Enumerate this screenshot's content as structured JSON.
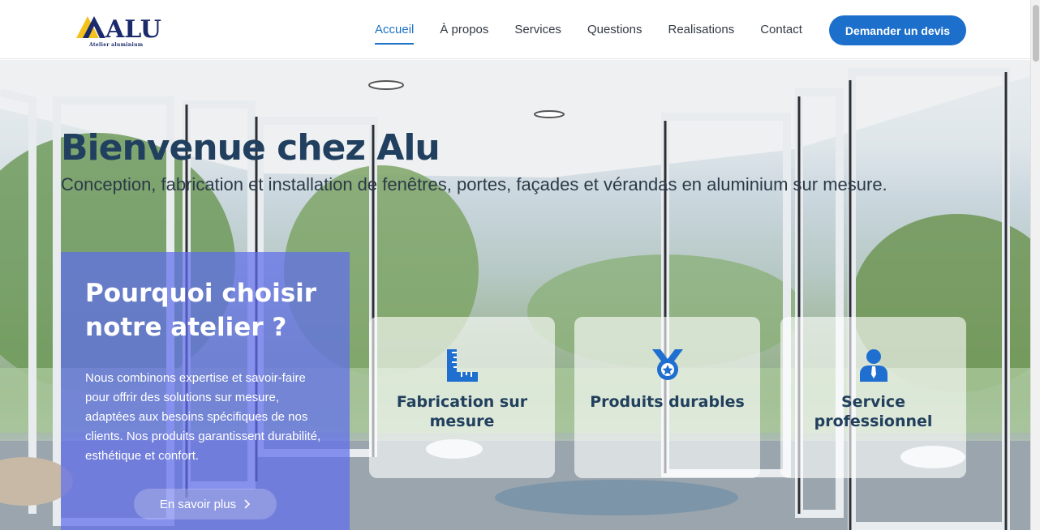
{
  "header": {
    "logo_text": "ALU",
    "logo_subtitle": "Atelier aluminium",
    "nav": [
      {
        "label": "Accueil",
        "active": true
      },
      {
        "label": "À propos",
        "active": false
      },
      {
        "label": "Services",
        "active": false
      },
      {
        "label": "Questions",
        "active": false
      },
      {
        "label": "Realisations",
        "active": false
      },
      {
        "label": "Contact",
        "active": false
      }
    ],
    "cta_label": "Demander un devis"
  },
  "hero": {
    "title": "Bienvenue chez Alu",
    "subtitle": "Conception, fabrication et installation de fenêtres, portes, façades et vérandas en aluminium sur mesure."
  },
  "why": {
    "title": "Pourquoi choisir notre atelier ?",
    "text": "Nous combinons expertise et savoir-faire pour offrir des solutions sur mesure, adaptées aux besoins spécifiques de nos clients. Nos produits garantissent durabilité, esthétique et confort.",
    "button_label": "En savoir plus",
    "button_icon": "chevron-right-icon"
  },
  "features": [
    {
      "label": "Fabrication sur mesure",
      "icon": "ruler-icon"
    },
    {
      "label": "Produits durables",
      "icon": "medal-icon"
    },
    {
      "label": "Service professionnel",
      "icon": "user-tie-icon"
    }
  ],
  "colors": {
    "accent": "#1d6fcc",
    "title": "#21405f",
    "panel": "#5f6eeb",
    "icon": "#1f6fd0"
  }
}
